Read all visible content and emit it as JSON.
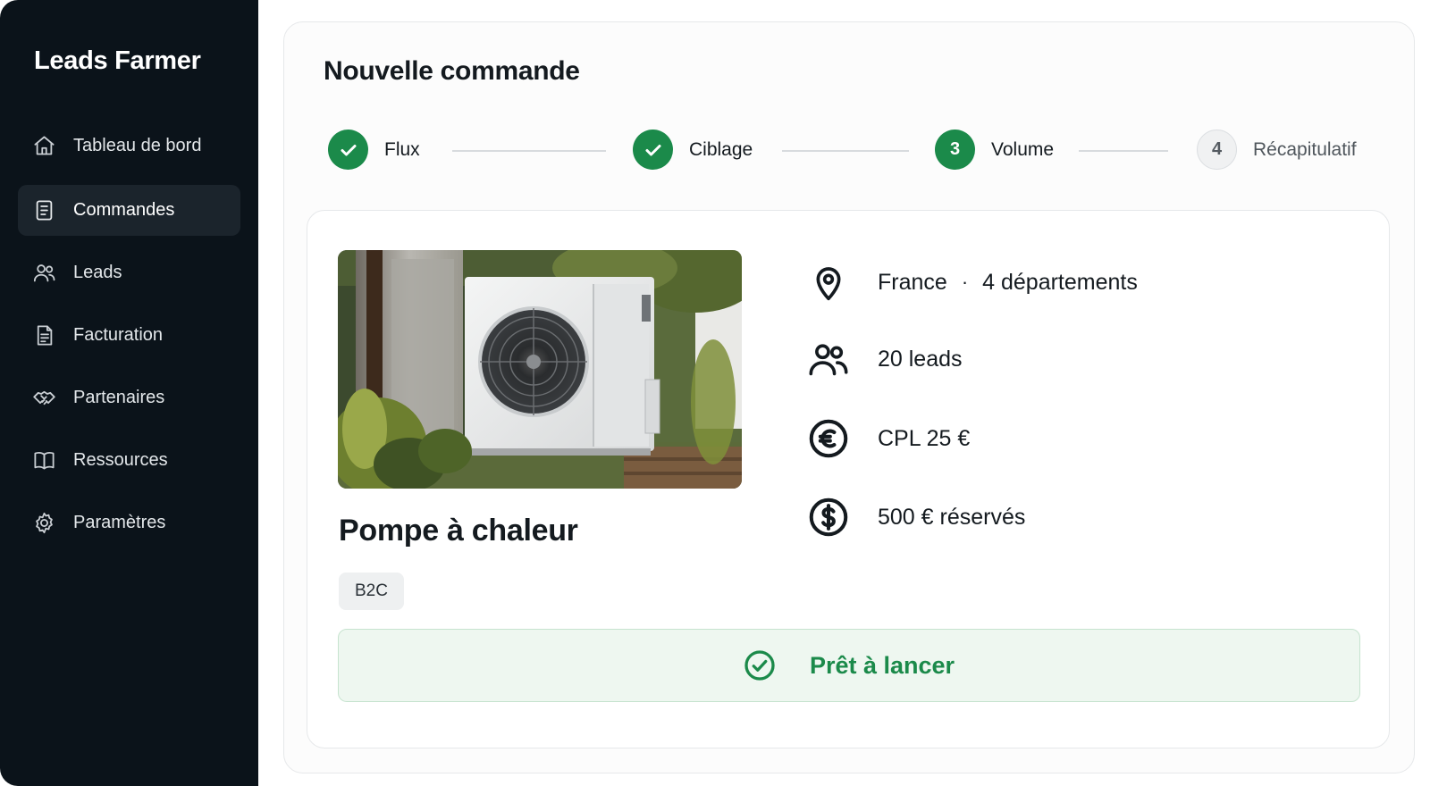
{
  "app": {
    "name": "Leads Farmer"
  },
  "sidebar": {
    "items": [
      {
        "label": "Tableau de bord",
        "icon": "home-icon",
        "active": false
      },
      {
        "label": "Commandes",
        "icon": "document-icon",
        "active": true
      },
      {
        "label": "Leads",
        "icon": "users-icon",
        "active": false
      },
      {
        "label": "Facturation",
        "icon": "invoice-icon",
        "active": false
      },
      {
        "label": "Partenaires",
        "icon": "handshake-icon",
        "active": false
      },
      {
        "label": "Ressources",
        "icon": "book-icon",
        "active": false
      },
      {
        "label": "Paramètres",
        "icon": "gear-icon",
        "active": false
      }
    ]
  },
  "page": {
    "title": "Nouvelle commande"
  },
  "stepper": {
    "steps": [
      {
        "number": "1",
        "label": "Flux",
        "status": "done"
      },
      {
        "number": "2",
        "label": "Ciblage",
        "status": "done"
      },
      {
        "number": "3",
        "label": "Volume",
        "status": "current"
      },
      {
        "number": "4",
        "label": "Récapitulatif",
        "status": "pending"
      }
    ]
  },
  "product": {
    "title": "Pompe à chaleur",
    "tag": "B2C",
    "image": "heat-pump-outdoor-unit-photo"
  },
  "summary": {
    "location": {
      "country": "France",
      "separator": "·",
      "departments": "4 départements",
      "icon": "location-pin-icon"
    },
    "leads": {
      "text": "20 leads",
      "icon": "users-icon"
    },
    "cpl": {
      "text": "CPL 25 €",
      "icon": "euro-icon"
    },
    "reserved": {
      "text": "500 € réservés",
      "icon": "dollar-icon"
    }
  },
  "status": {
    "label": "Prêt à lancer",
    "icon": "check-circle-icon"
  },
  "colors": {
    "sidebar_bg": "#0b131a",
    "accent_green": "#1b8a4a",
    "ready_bg": "#eef7f0"
  }
}
